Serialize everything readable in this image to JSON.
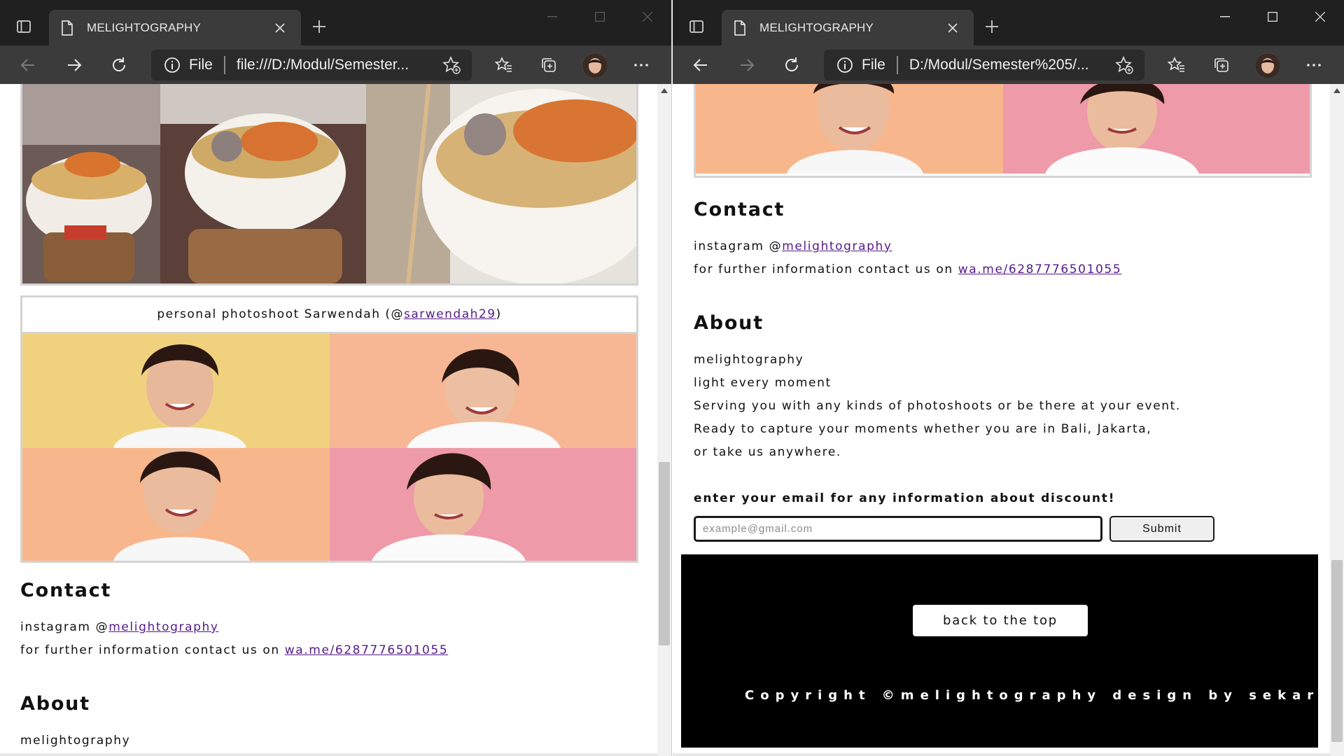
{
  "tab": {
    "title": "MELIGHTOGRAPHY"
  },
  "left": {
    "address": {
      "scheme": "File",
      "url": "file:///D:/Modul/Semester..."
    },
    "gallery": {
      "caption_prefix": "personal photoshoot Sarwendah (@",
      "caption_handle": "sarwendah29",
      "caption_suffix": ")"
    }
  },
  "right": {
    "address": {
      "scheme": "File",
      "url": "D:/Modul/Semester%205/..."
    }
  },
  "contact": {
    "heading": "Contact",
    "instagram_prefix": "instagram @",
    "instagram_handle": "melightography",
    "info_prefix": "for further information contact us on ",
    "wa_link": "wa.me/6287776501055"
  },
  "about": {
    "heading": "About",
    "lines": [
      "melightography",
      "light every moment",
      "Serving you with any kinds of photoshoots or be there at your event.",
      "Ready to capture your moments whether you are in Bali, Jakarta,",
      "or take us anywhere."
    ]
  },
  "newsletter": {
    "label": "enter your email for any information about discount!",
    "placeholder": "example@gmail.com",
    "submit_label": "Submit"
  },
  "footer": {
    "back_to_top": "back to the top",
    "copyright": "Copyright ©melightography design by sekar alit"
  },
  "colors": {
    "titlebar": "#202020",
    "toolbar": "#3b3b3b",
    "link": "#551a8b",
    "footer_bg": "#000000"
  },
  "icons": [
    "tab-actions-icon",
    "page-icon",
    "close-icon",
    "plus-icon",
    "back-icon",
    "forward-icon",
    "refresh-icon",
    "info-icon",
    "add-favorite-icon",
    "favorites-icon",
    "collections-icon",
    "more-icon",
    "minimize-icon",
    "maximize-icon"
  ]
}
